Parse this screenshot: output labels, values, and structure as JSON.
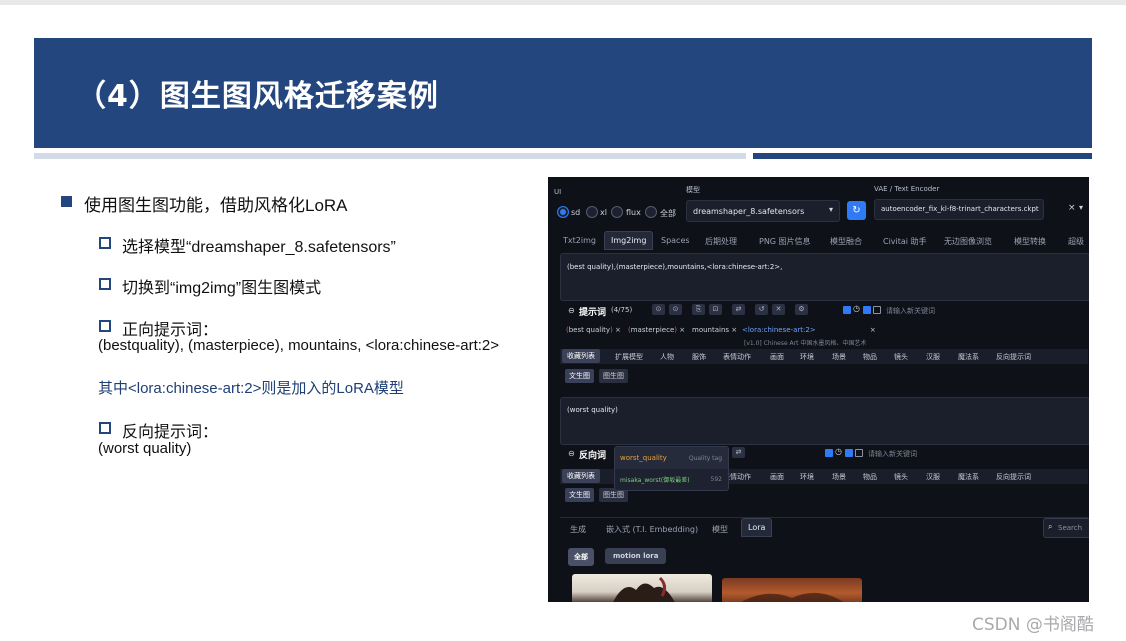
{
  "slide": {
    "title": "（4）图生图风格迁移案例",
    "bullet_main": "使用图生图功能，借助风格化LoRA",
    "sub1": "选择模型“dreamshaper_8.safetensors”",
    "sub2": "切换到“img2img”图生图模式",
    "sub3_label": "正向提示词：",
    "sub3_value": "(bestquality), (masterpiece), mountains, <lora:chinese-art:2>",
    "note": "其中<lora:chinese-art:2>则是加入的LoRA模型",
    "sub4_label": "反向提示词：",
    "sub4_value": "(worst quality)",
    "watermark": "CSDN @书阁酷"
  },
  "colors": {
    "banner": "#24467e",
    "note_text": "#1f3f76",
    "panel_bg": "#0f1119",
    "accent": "#2f7bf6"
  },
  "ui": {
    "ui_label": "UI",
    "model_label": "模型",
    "vae_label": "VAE / Text Encoder",
    "radios": [
      "sd",
      "xl",
      "flux",
      "全部"
    ],
    "model_value": "dreamshaper_8.safetensors",
    "vae_value": "autoencoder_fix_kl-f8-trinart_characters.ckpt",
    "tabs": [
      "Txt2img",
      "Img2img",
      "Spaces",
      "后期处理",
      "PNG 图片信息",
      "模型融合",
      "Civitai 助手",
      "无边图像浏览",
      "模型转换",
      "超级"
    ],
    "positive_prompt": "(best quality),(masterpiece),mountains,<lora:chinese-art:2>,",
    "prompt_label": "提示词",
    "prompt_count": "(4/75)",
    "keyword_placeholder": "请输入新关键词",
    "tags": [
      "best quality",
      "masterpiece",
      "mountains",
      "<lora:chinese-art:2>"
    ],
    "tag_hint": "[v1.0] Chinese Art 中国水墨风格、中国艺术",
    "categories": [
      "收藏列表",
      "扩展模型",
      "人物",
      "服饰",
      "表情动作",
      "画面",
      "环境",
      "场景",
      "物品",
      "镜头",
      "汉服",
      "魔法系",
      "反向提示词"
    ],
    "subtabs": [
      "文生图",
      "图生图"
    ],
    "negative_prompt": "(worst quality)",
    "neg_label": "反向词",
    "neg_categories": [
      "收藏列表",
      "表情动作",
      "画面",
      "环境",
      "场景",
      "物品",
      "镜头",
      "汉服",
      "魔法系",
      "反向提示词"
    ],
    "autocomplete": [
      {
        "term": "worst_quality",
        "type": "Quality tag"
      },
      {
        "term": "misaka_worst(御坂最差)",
        "type": "592"
      }
    ],
    "bottom_tabs": [
      "生成",
      "嵌入式 (T.I. Embedding)",
      "模型",
      "Lora"
    ],
    "search_placeholder": "Search",
    "lora_filters": [
      "全部",
      "motion lora"
    ]
  }
}
